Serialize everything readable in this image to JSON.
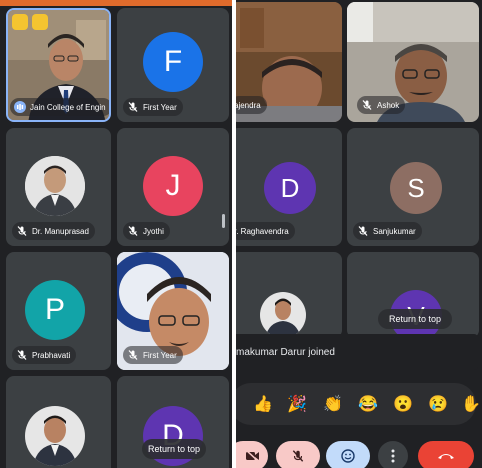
{
  "left_grid": {
    "tiles": [
      {
        "name": "Jain College of Engin",
        "type": "video"
      },
      {
        "name": "First Year",
        "initial": "F",
        "color": "#1a73e8"
      },
      {
        "name": "Dr. Manuprasad",
        "type": "photo"
      },
      {
        "name": "Jyothi",
        "initial": "J",
        "color": "#e8445f"
      },
      {
        "name": "Prabhavati",
        "initial": "P",
        "color": "#12a4a8"
      },
      {
        "name": "First Year",
        "type": "video"
      },
      {
        "name": "",
        "type": "photo"
      },
      {
        "initial": "D",
        "color": "#5e35b1"
      }
    ],
    "return_to_top": "Return to top"
  },
  "right_grid": {
    "tiles": [
      {
        "name": "ajendra",
        "type": "video"
      },
      {
        "name": "Ashok",
        "type": "video"
      },
      {
        "name": "r. Raghavendra",
        "initial": "D",
        "color": "#5e35b1"
      },
      {
        "name": "Sanjukumar",
        "initial": "S",
        "color": "#8d6e63"
      },
      {
        "name": "",
        "type": "photo"
      },
      {
        "initial": "V",
        "color": "#5e35b1"
      }
    ],
    "return_to_top": "Return to top",
    "join_notice": "makumar Darur joined",
    "reactions": [
      "👍",
      "🎉",
      "👏",
      "😂",
      "😮",
      "😢",
      "✋"
    ]
  },
  "colors": {
    "bg": "#202124",
    "tile": "#3c4043",
    "accent_bar": "#e06b2c",
    "end_call": "#ea4335",
    "control_muted": "#f8c9c7",
    "control_active": "#c2dbfa"
  }
}
